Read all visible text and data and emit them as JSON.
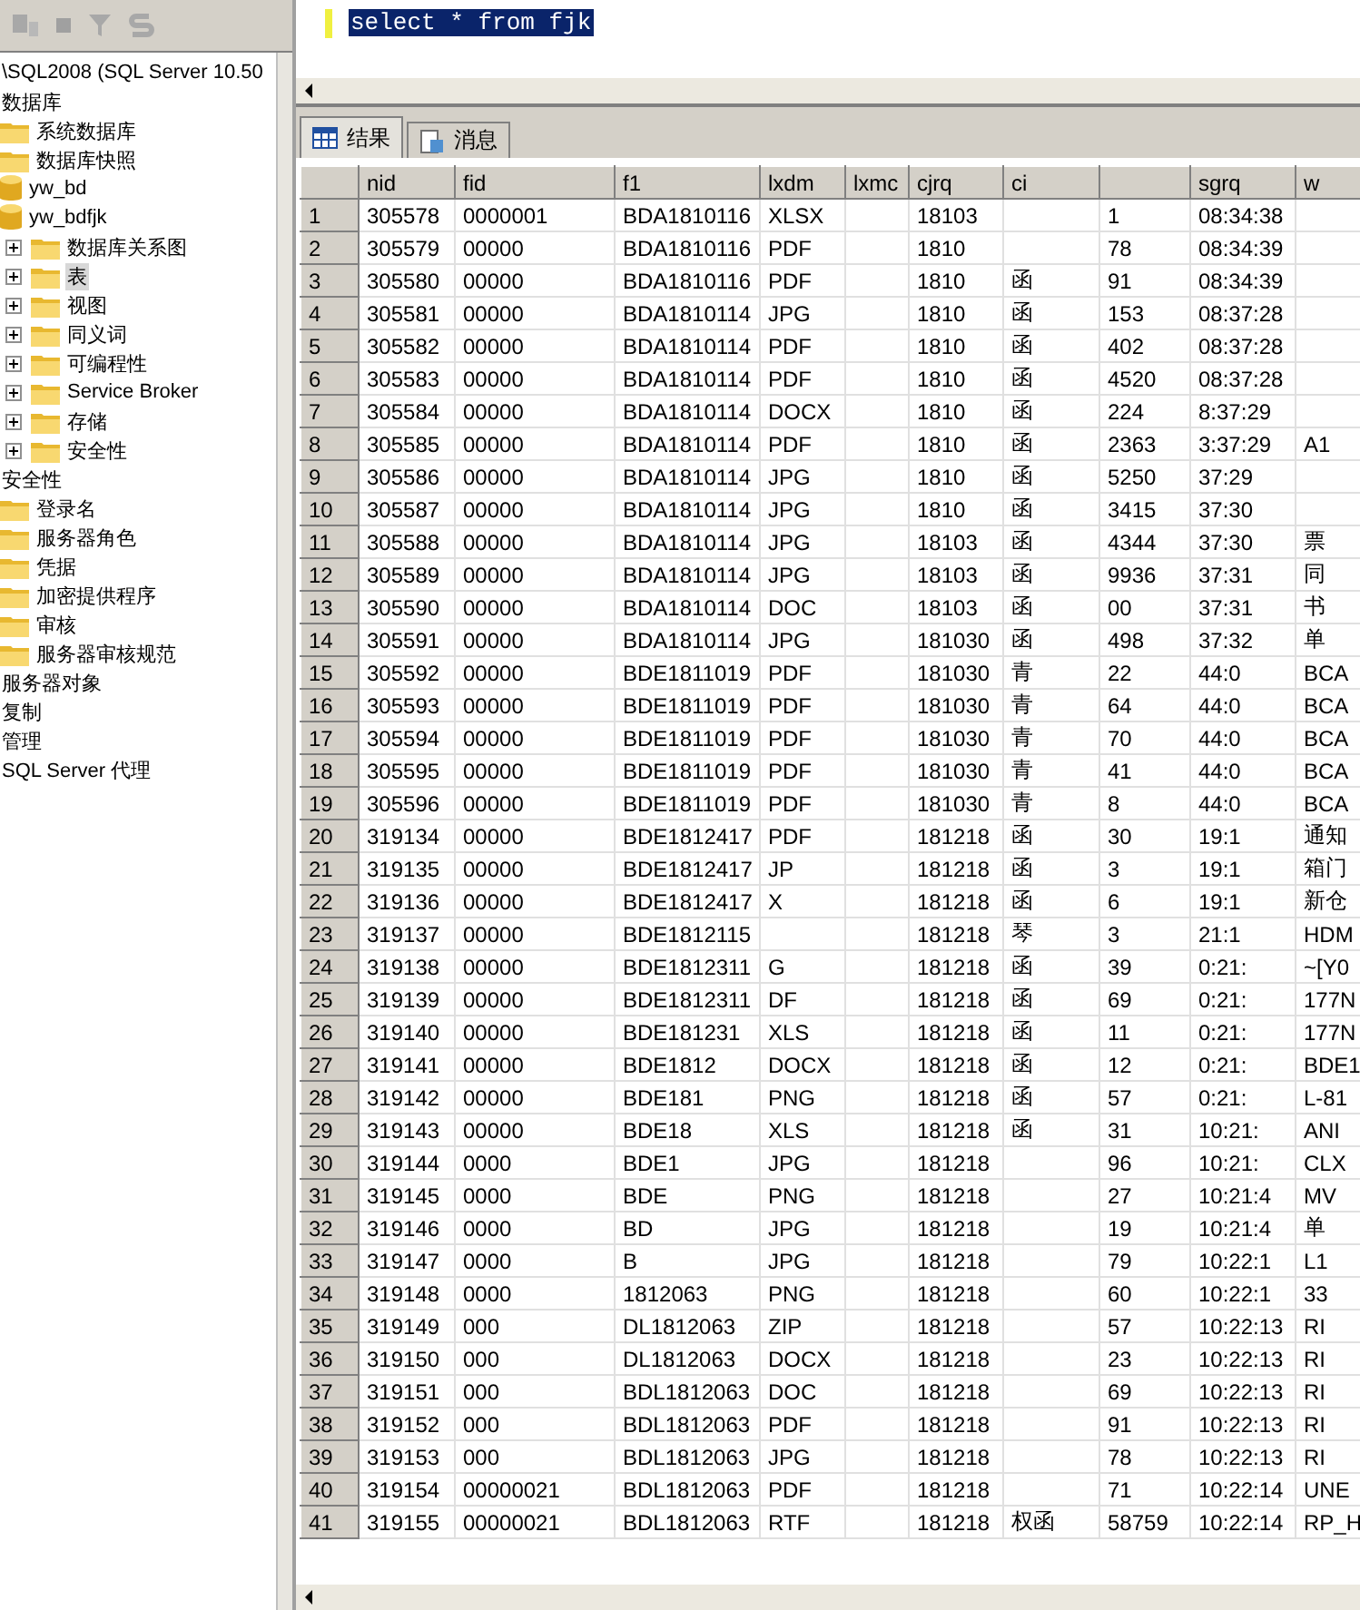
{
  "object_explorer": {
    "tree": [
      {
        "label": "\\SQL2008 (SQL Server 10.50",
        "expandable": false,
        "selected": false,
        "children": [
          {
            "label": "数据库",
            "expandable": false,
            "selected": false,
            "children": [
              {
                "label": "系统数据库",
                "kind": "folder",
                "expandable": false,
                "selected": false
              },
              {
                "label": "数据库快照",
                "kind": "folder",
                "expandable": false,
                "selected": false
              },
              {
                "label": "yw_bd",
                "kind": "database",
                "expandable": false,
                "selected": false
              },
              {
                "label": "yw_bdfjk",
                "kind": "database",
                "expandable": false,
                "selected": false,
                "children": [
                  {
                    "label": "数据库关系图",
                    "kind": "folder",
                    "expandable": true,
                    "selected": false
                  },
                  {
                    "label": "表",
                    "kind": "folder",
                    "expandable": true,
                    "selected": true
                  },
                  {
                    "label": "视图",
                    "kind": "folder",
                    "expandable": true,
                    "selected": false
                  },
                  {
                    "label": "同义词",
                    "kind": "folder",
                    "expandable": true,
                    "selected": false
                  },
                  {
                    "label": "可编程性",
                    "kind": "folder",
                    "expandable": true,
                    "selected": false
                  },
                  {
                    "label": "Service Broker",
                    "kind": "folder",
                    "expandable": true,
                    "selected": false
                  },
                  {
                    "label": "存储",
                    "kind": "folder",
                    "expandable": true,
                    "selected": false
                  },
                  {
                    "label": "安全性",
                    "kind": "folder",
                    "expandable": true,
                    "selected": false
                  }
                ]
              }
            ]
          },
          {
            "label": "安全性",
            "expandable": false,
            "selected": false,
            "children": [
              {
                "label": "登录名",
                "kind": "folder",
                "expandable": false,
                "selected": false
              },
              {
                "label": "服务器角色",
                "kind": "folder",
                "expandable": false,
                "selected": false
              },
              {
                "label": "凭据",
                "kind": "folder",
                "expandable": false,
                "selected": false
              },
              {
                "label": "加密提供程序",
                "kind": "folder",
                "expandable": false,
                "selected": false
              },
              {
                "label": "审核",
                "kind": "folder",
                "expandable": false,
                "selected": false
              },
              {
                "label": "服务器审核规范",
                "kind": "folder",
                "expandable": false,
                "selected": false
              }
            ]
          },
          {
            "label": "服务器对象",
            "expandable": false,
            "selected": false
          },
          {
            "label": "复制",
            "expandable": false,
            "selected": false
          },
          {
            "label": "管理",
            "expandable": false,
            "selected": false
          },
          {
            "label": "SQL Server 代理",
            "expandable": false,
            "selected": false
          }
        ]
      }
    ]
  },
  "editor": {
    "lines": [
      {
        "text": "select * from fjk",
        "highlighted": true
      }
    ]
  },
  "result_tabs": [
    {
      "label": "结果",
      "kind": "grid",
      "selected": true
    },
    {
      "label": "消息",
      "kind": "message",
      "selected": false
    }
  ],
  "grid": {
    "columns": [
      {
        "label": "nid"
      },
      {
        "label": "fid"
      },
      {
        "label": "f1"
      },
      {
        "label": "lxdm"
      },
      {
        "label": "lxmc"
      },
      {
        "label": "cjrq"
      },
      {
        "label": "ci"
      },
      {},
      {
        "label": "sgrq"
      },
      {
        "label": "w"
      }
    ],
    "rows": [
      {
        "num": "1",
        "cells": [
          "305578",
          "0000001",
          "BDA1810116",
          "XLSX",
          null,
          "18103",
          null,
          "1",
          "08:34:38",
          null
        ]
      },
      {
        "num": "2",
        "cells": [
          "305579",
          "00000",
          "BDA1810116",
          "PDF",
          null,
          "1810",
          null,
          "78",
          "08:34:39",
          null
        ]
      },
      {
        "num": "3",
        "cells": [
          "305580",
          "00000",
          "BDA1810116",
          "PDF",
          null,
          "1810",
          "函",
          "91",
          "08:34:39",
          null
        ]
      },
      {
        "num": "4",
        "cells": [
          "305581",
          "00000",
          "BDA1810114",
          "JPG",
          null,
          "1810",
          "函",
          "153",
          "08:37:28",
          null
        ]
      },
      {
        "num": "5",
        "cells": [
          "305582",
          "00000",
          "BDA1810114",
          "PDF",
          null,
          "1810",
          "函",
          "402",
          "08:37:28",
          null
        ]
      },
      {
        "num": "6",
        "cells": [
          "305583",
          "00000",
          "BDA1810114",
          "PDF",
          null,
          "1810",
          "函",
          "4520",
          "08:37:28",
          null
        ]
      },
      {
        "num": "7",
        "cells": [
          "305584",
          "00000",
          "BDA1810114",
          "DOCX",
          null,
          "1810",
          "函",
          "224",
          "8:37:29",
          null
        ]
      },
      {
        "num": "8",
        "cells": [
          "305585",
          "00000",
          "BDA1810114",
          "PDF",
          null,
          "1810",
          "函",
          "2363",
          "3:37:29",
          "A1"
        ]
      },
      {
        "num": "9",
        "cells": [
          "305586",
          "00000",
          "BDA1810114",
          "JPG",
          null,
          "1810",
          "函",
          "5250",
          "37:29",
          null
        ]
      },
      {
        "num": "10",
        "cells": [
          "305587",
          "00000",
          "BDA1810114",
          "JPG",
          null,
          "1810",
          "函",
          "3415",
          "37:30",
          null
        ]
      },
      {
        "num": "11",
        "cells": [
          "305588",
          "00000",
          "BDA1810114",
          "JPG",
          null,
          "18103",
          "函",
          "4344",
          "37:30",
          "票"
        ]
      },
      {
        "num": "12",
        "cells": [
          "305589",
          "00000",
          "BDA1810114",
          "JPG",
          null,
          "18103",
          "函",
          "9936",
          "37:31",
          "同"
        ]
      },
      {
        "num": "13",
        "cells": [
          "305590",
          "00000",
          "BDA1810114",
          "DOC",
          null,
          "18103",
          "函",
          "00",
          "37:31",
          "书"
        ]
      },
      {
        "num": "14",
        "cells": [
          "305591",
          "00000",
          "BDA1810114",
          "JPG",
          null,
          "181030",
          "函",
          "498",
          "37:32",
          "单"
        ]
      },
      {
        "num": "15",
        "cells": [
          "305592",
          "00000",
          "BDE1811019",
          "PDF",
          null,
          "181030",
          "青",
          "22",
          "44:0",
          "BCA"
        ]
      },
      {
        "num": "16",
        "cells": [
          "305593",
          "00000",
          "BDE1811019",
          "PDF",
          null,
          "181030",
          "青",
          "64",
          "44:0",
          "BCA"
        ]
      },
      {
        "num": "17",
        "cells": [
          "305594",
          "00000",
          "BDE1811019",
          "PDF",
          null,
          "181030",
          "青",
          "70",
          "44:0",
          "BCA"
        ]
      },
      {
        "num": "18",
        "cells": [
          "305595",
          "00000",
          "BDE1811019",
          "PDF",
          null,
          "181030",
          "青",
          "41",
          "44:0",
          "BCA"
        ]
      },
      {
        "num": "19",
        "cells": [
          "305596",
          "00000",
          "BDE1811019",
          "PDF",
          null,
          "181030",
          "青",
          "8",
          "44:0",
          "BCA"
        ]
      },
      {
        "num": "20",
        "cells": [
          "319134",
          "00000",
          "BDE1812417",
          "PDF",
          null,
          "181218",
          "函",
          "30",
          "19:1",
          "通知"
        ]
      },
      {
        "num": "21",
        "cells": [
          "319135",
          "00000",
          "BDE1812417",
          "JP",
          null,
          "181218",
          "函",
          "3",
          "19:1",
          "箱门"
        ]
      },
      {
        "num": "22",
        "cells": [
          "319136",
          "00000",
          "BDE1812417",
          "X",
          null,
          "181218",
          "函",
          "6",
          "19:1",
          "新仓"
        ]
      },
      {
        "num": "23",
        "cells": [
          "319137",
          "00000",
          "BDE1812115",
          null,
          null,
          "181218",
          "琴",
          "3",
          "21:1",
          "HDM"
        ]
      },
      {
        "num": "24",
        "cells": [
          "319138",
          "00000",
          "BDE1812311",
          "G",
          null,
          "181218",
          "函",
          "39",
          "0:21:",
          "~[Y0"
        ]
      },
      {
        "num": "25",
        "cells": [
          "319139",
          "00000",
          "BDE1812311",
          "DF",
          null,
          "181218",
          "函",
          "69",
          "0:21:",
          "177N"
        ]
      },
      {
        "num": "26",
        "cells": [
          "319140",
          "00000",
          "BDE181231",
          "XLS",
          null,
          "181218",
          "函",
          "11",
          "0:21:",
          "177N"
        ]
      },
      {
        "num": "27",
        "cells": [
          "319141",
          "00000",
          "BDE1812",
          "DOCX",
          null,
          "181218",
          "函",
          "12",
          "0:21:",
          "BDE1"
        ]
      },
      {
        "num": "28",
        "cells": [
          "319142",
          "00000",
          "BDE181",
          "PNG",
          null,
          "181218",
          "函",
          "57",
          "0:21:",
          "L-81"
        ]
      },
      {
        "num": "29",
        "cells": [
          "319143",
          "00000",
          "BDE18",
          "XLS",
          null,
          "181218",
          "函",
          "31",
          "10:21:",
          "ANI"
        ]
      },
      {
        "num": "30",
        "cells": [
          "319144",
          "0000",
          "BDE1",
          "JPG",
          null,
          "181218",
          null,
          "96",
          "10:21:",
          "CLX"
        ]
      },
      {
        "num": "31",
        "cells": [
          "319145",
          "0000",
          "BDE",
          "PNG",
          null,
          "181218",
          null,
          "27",
          "10:21:4",
          "MV"
        ]
      },
      {
        "num": "32",
        "cells": [
          "319146",
          "0000",
          "BD",
          "JPG",
          null,
          "181218",
          null,
          "19",
          "10:21:4",
          "单"
        ]
      },
      {
        "num": "33",
        "cells": [
          "319147",
          "0000",
          "B",
          "JPG",
          null,
          "181218",
          null,
          "79",
          "10:22:1",
          "L1"
        ]
      },
      {
        "num": "34",
        "cells": [
          "319148",
          "0000",
          "1812063",
          "PNG",
          null,
          "181218",
          null,
          "60",
          "10:22:1",
          "33"
        ]
      },
      {
        "num": "35",
        "cells": [
          "319149",
          "000",
          "DL1812063",
          "ZIP",
          null,
          "181218",
          null,
          "57",
          "10:22:13",
          "RI"
        ]
      },
      {
        "num": "36",
        "cells": [
          "319150",
          "000",
          "DL1812063",
          "DOCX",
          null,
          "181218",
          null,
          "23",
          "10:22:13",
          "RI"
        ]
      },
      {
        "num": "37",
        "cells": [
          "319151",
          "000",
          "BDL1812063",
          "DOC",
          null,
          "181218",
          null,
          "69",
          "10:22:13",
          "RI"
        ]
      },
      {
        "num": "38",
        "cells": [
          "319152",
          "000",
          "BDL1812063",
          "PDF",
          null,
          "181218",
          null,
          "91",
          "10:22:13",
          "RI"
        ]
      },
      {
        "num": "39",
        "cells": [
          "319153",
          "000",
          "BDL1812063",
          "JPG",
          null,
          "181218",
          null,
          "78",
          "10:22:13",
          "RI"
        ]
      },
      {
        "num": "40",
        "cells": [
          "319154",
          "00000021",
          "BDL1812063",
          "PDF",
          null,
          "181218",
          null,
          "71",
          "10:22:14",
          "UNE"
        ]
      },
      {
        "num": "41",
        "cells": [
          "319155",
          "00000021",
          "BDL1812063",
          "RTF",
          null,
          "181218",
          "权函",
          "58759",
          "10:22:14",
          "RP_H"
        ]
      }
    ]
  }
}
